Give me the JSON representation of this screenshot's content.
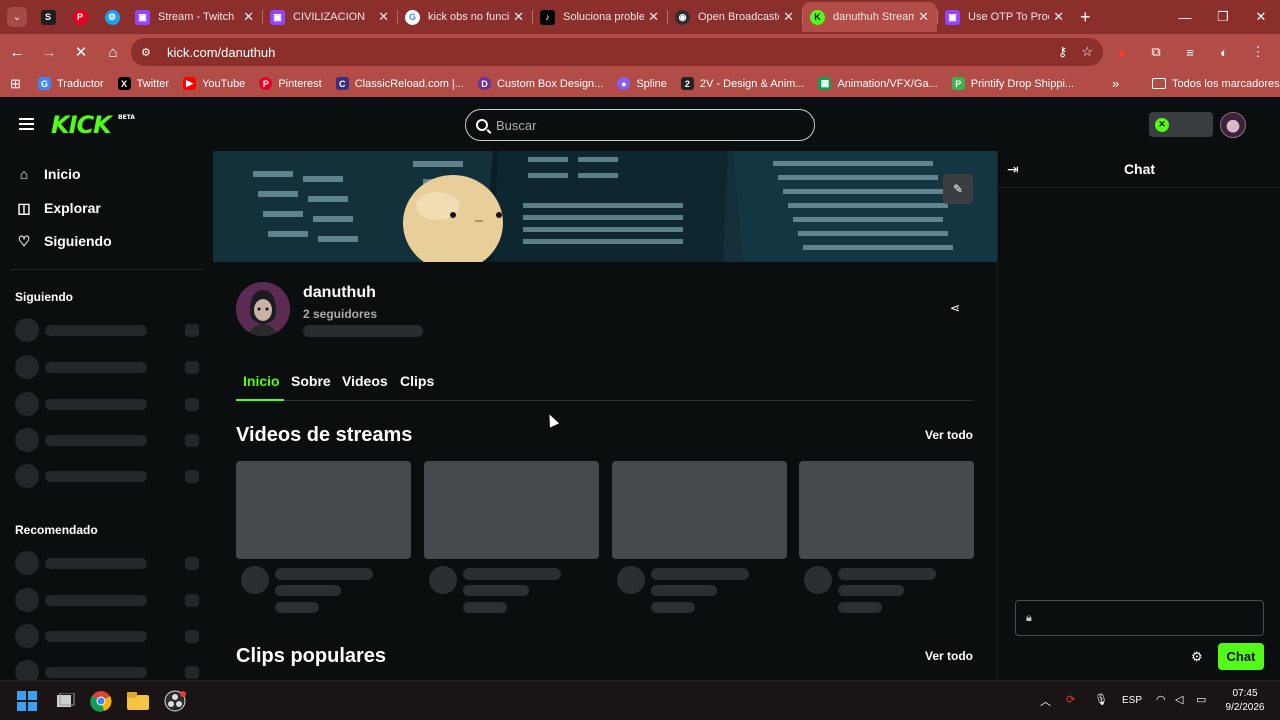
{
  "browser": {
    "tabs": [
      {
        "title": "",
        "icon": "scribd-icon",
        "color": "#1e1e1e",
        "pinned": true
      },
      {
        "title": "",
        "icon": "pinterest-icon",
        "color": "#e60023",
        "pinned": true
      },
      {
        "title": "",
        "icon": "settings-app-icon",
        "color": "#1da1f2",
        "pinned": true
      },
      {
        "title": "Stream - Twitch",
        "icon": "twitch-icon",
        "color": "#9146ff"
      },
      {
        "title": "CIVILIZACION",
        "icon": "twitch-icon",
        "color": "#9146ff"
      },
      {
        "title": "kick obs no funci",
        "icon": "google-icon",
        "color": "#ffffff"
      },
      {
        "title": "Soluciona proble",
        "icon": "tiktok-icon",
        "color": "#000000"
      },
      {
        "title": "Open Broadcaste",
        "icon": "obs-icon",
        "color": "#302e31"
      },
      {
        "title": "danuthuh Stream",
        "icon": "kick-icon",
        "color": "#53fc18",
        "active": true
      },
      {
        "title": "Use OTP To Proc",
        "icon": "twitch-icon",
        "color": "#9146ff"
      }
    ],
    "url": "kick.com/danuthuh",
    "bookmarks": [
      {
        "label": "Traductor",
        "icon": "translate-icon",
        "color": "#4285f4"
      },
      {
        "label": "Twitter",
        "icon": "x-icon",
        "color": "#000000"
      },
      {
        "label": "YouTube",
        "icon": "youtube-icon",
        "color": "#ff0000"
      },
      {
        "label": "Pinterest",
        "icon": "pinterest-icon",
        "color": "#e60023"
      },
      {
        "label": "ClassicReload.com |...",
        "icon": "classicreload-icon",
        "color": "#3a2f7a"
      },
      {
        "label": "Custom Box Design...",
        "icon": "custombox-icon",
        "color": "#6b2fa3"
      },
      {
        "label": "Spline",
        "icon": "spline-icon",
        "color": "#8a5cf6"
      },
      {
        "label": "2V - Design & Anim...",
        "icon": "2v-icon",
        "color": "#222222"
      },
      {
        "label": "Animation/VFX/Ga...",
        "icon": "sheets-icon",
        "color": "#0f9d58"
      },
      {
        "label": "Printify Drop Shippi...",
        "icon": "printify-icon",
        "color": "#39b54a"
      }
    ],
    "bookmarks_all": "Todos los marcadores",
    "more": "»"
  },
  "kick": {
    "brand_color": "#53fc18",
    "logo_text": "KICK",
    "logo_beta": "BETA",
    "search_placeholder": "Buscar",
    "nav": [
      {
        "label": "Inicio",
        "icon": "home-icon"
      },
      {
        "label": "Explorar",
        "icon": "compass-icon"
      },
      {
        "label": "Siguiendo",
        "icon": "heart-icon"
      }
    ],
    "following_heading": "Siguiendo",
    "recommended_heading": "Recomendado",
    "channel": {
      "name": "danuthuh",
      "followers": "2 seguidores"
    },
    "tabs": [
      "Inicio",
      "Sobre",
      "Videos",
      "Clips"
    ],
    "sections": {
      "streams_title": "Videos de streams",
      "clips_title": "Clips populares",
      "see_all": "Ver todo"
    },
    "chat": {
      "title": "Chat",
      "send_label": "Chat"
    }
  },
  "taskbar": {
    "language": "ESP",
    "time": "07:45",
    "date": "9/2/2026"
  }
}
